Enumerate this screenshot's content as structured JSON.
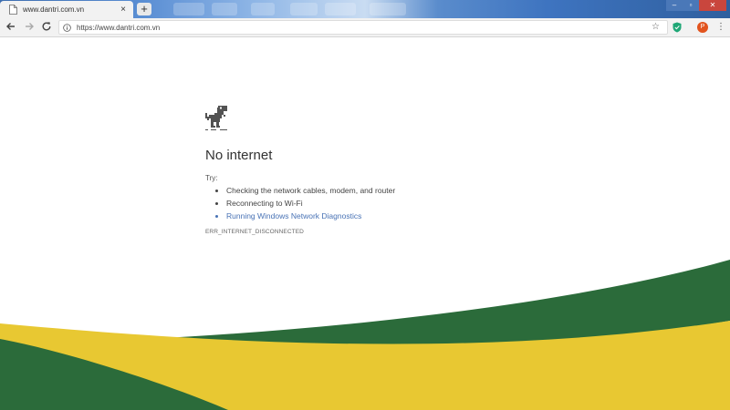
{
  "browser": {
    "tab": {
      "title": "www.dantri.com.vn",
      "page_icon": "page-icon",
      "close_label": "×"
    },
    "new_tab_label": "+",
    "window_controls": {
      "minimize": "–",
      "maximize": "▫",
      "close": "✕"
    },
    "toolbar": {
      "back_icon": "arrow-left-icon",
      "forward_icon": "arrow-right-icon",
      "reload_icon": "reload-icon",
      "url": "https://www.dantri.com.vn",
      "bookmark_icon": "star-icon",
      "extension_icon": "shield-icon",
      "profile_initial": "P",
      "menu_icon": "menu-dots-icon"
    }
  },
  "error_page": {
    "icon": "dino-icon",
    "title": "No internet",
    "try_label": "Try:",
    "suggestions": [
      "Checking the network cables, modem, and router",
      "Reconnecting to Wi-Fi",
      "Running Windows Network Diagnostics"
    ],
    "error_code": "ERR_INTERNET_DISCONNECTED"
  },
  "colors": {
    "link": "#4872b5",
    "wave_green": "#2b6b3a",
    "wave_yellow": "#e8c832",
    "avatar": "#e2541e"
  }
}
